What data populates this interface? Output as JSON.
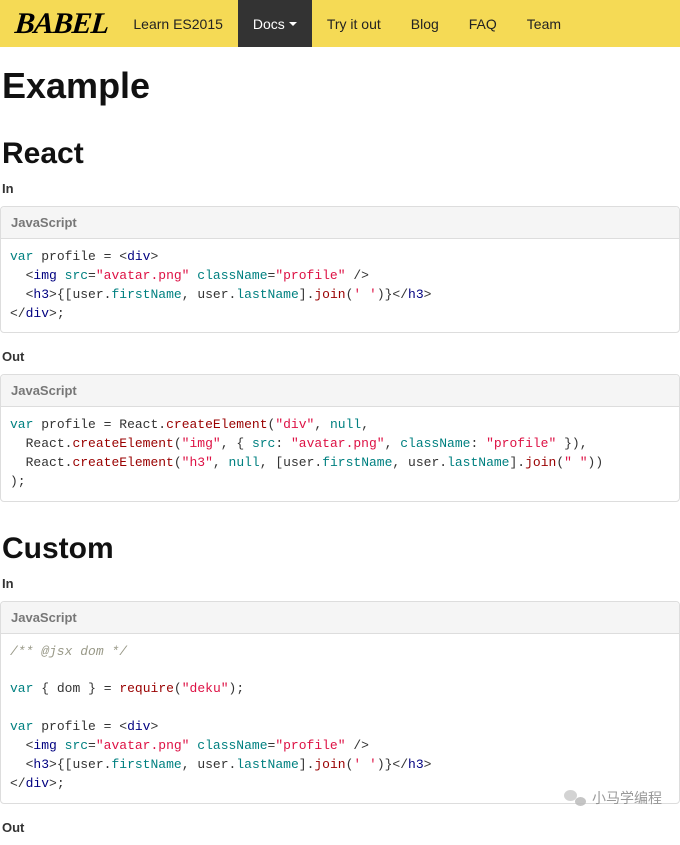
{
  "nav": {
    "brand": "BABEL",
    "items": [
      "Learn ES2015",
      "Docs",
      "Try it out",
      "Blog",
      "FAQ",
      "Team"
    ],
    "activeIndex": 1
  },
  "headings": {
    "title": "Example",
    "section1": "React",
    "section2": "Custom",
    "in": "In",
    "out": "Out",
    "codeLang": "JavaScript"
  },
  "watermark": "小马学编程"
}
